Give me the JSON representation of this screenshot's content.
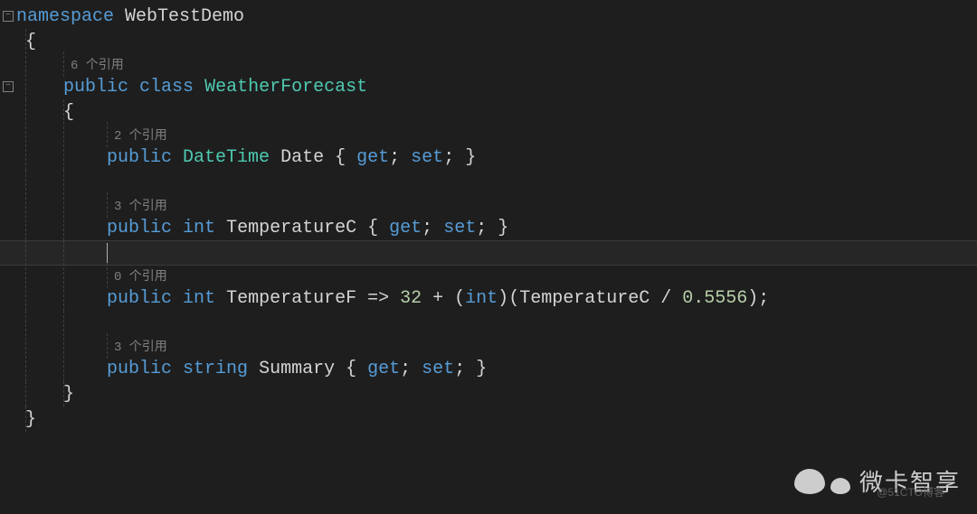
{
  "code": {
    "ns_kw": "namespace",
    "ns_name": " WebTestDemo",
    "open_brace": "{",
    "close_brace": "}",
    "ref6": "6 个引用",
    "public_kw": "public",
    "class_kw": "class",
    "class_name": "WeatherForecast",
    "ref2": "2 个引用",
    "datetime_t": "DateTime",
    "date_prop": "Date",
    "get_kw": "get",
    "set_kw": "set",
    "semi": ";",
    "space": " ",
    "ref3a": "3 个引用",
    "int_t": "int",
    "tempc_prop": "TemperatureC",
    "ref0": "0 个引用",
    "tempf_prop": "TemperatureF",
    "arrow": " => ",
    "n32": "32",
    "plus": " + ",
    "lparen": "(",
    "rparen": ")",
    "div": " / ",
    "n05556": "0.5556",
    "ref3b": "3 个引用",
    "string_t": "string",
    "summary_prop": "Summary"
  },
  "watermark": {
    "text": "微卡智享",
    "sub": "@51CTO博客"
  }
}
